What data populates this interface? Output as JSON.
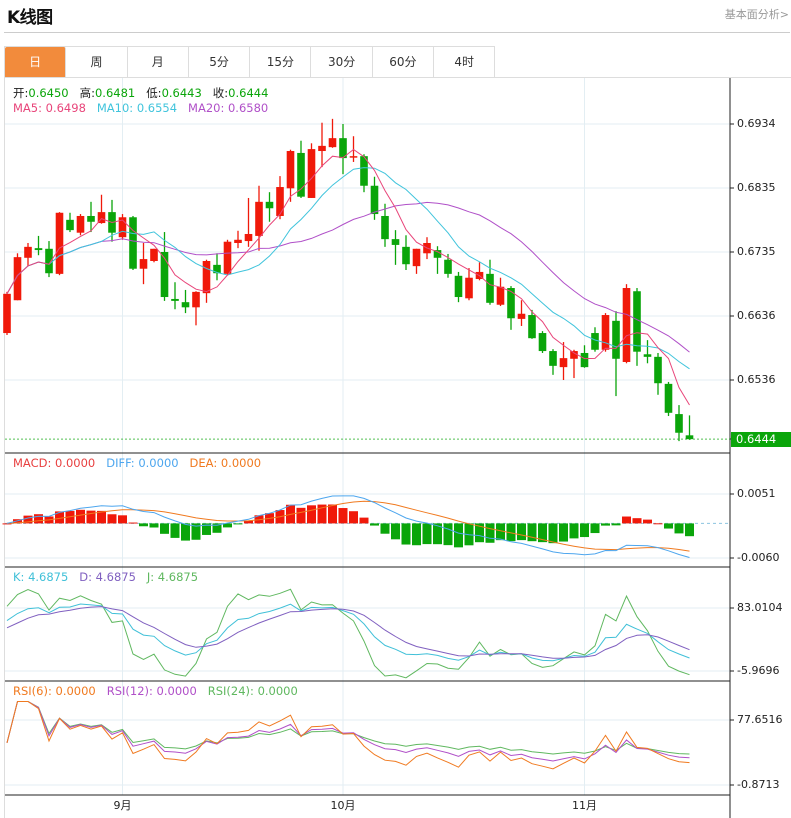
{
  "header": {
    "title": "K线图",
    "fundamental_link": "基本面分析>"
  },
  "tabs": [
    {
      "label": "日",
      "active": true
    },
    {
      "label": "周"
    },
    {
      "label": "月"
    },
    {
      "label": "5分"
    },
    {
      "label": "15分"
    },
    {
      "label": "30分"
    },
    {
      "label": "60分"
    },
    {
      "label": "4时"
    }
  ],
  "ohlc_legend": {
    "open_label": "开:",
    "open": "0.6450",
    "high_label": "高:",
    "high": "0.6481",
    "low_label": "低:",
    "low": "0.6443",
    "close_label": "收:",
    "close": "0.6444"
  },
  "ma_legend": {
    "ma5_label": "MA5:",
    "ma5": "0.6498",
    "ma10_label": "MA10:",
    "ma10": "0.6554",
    "ma20_label": "MA20:",
    "ma20": "0.6580"
  },
  "macd_legend": {
    "macd": "MACD: 0.0000",
    "diff": "DIFF: 0.0000",
    "dea": "DEA: 0.0000"
  },
  "kdj_legend": {
    "k": "K: 4.6875",
    "d": "D: 4.6875",
    "j": "J: 4.6875"
  },
  "rsi_legend": {
    "rsi6": "RSI(6): 0.0000",
    "rsi12": "RSI(12): 0.0000",
    "rsi24": "RSI(24): 0.0000"
  },
  "last_price": "0.6444",
  "colors": {
    "up": "#f0190a",
    "down": "#0aa50a",
    "ma5": "#e8457a",
    "ma10": "#40c4dc",
    "ma20": "#b050c8",
    "diff": "#4da6ee",
    "dea": "#f07a20",
    "k": "#40c0d8",
    "d": "#8060c0",
    "j": "#60b860",
    "accent": "#f28b3c"
  },
  "chart_data": {
    "type": "candlestick",
    "price_axis": {
      "ticks": [
        "0.6934",
        "0.6835",
        "0.6735",
        "0.6636",
        "0.6536"
      ],
      "range": [
        0.6934,
        0.6536
      ]
    },
    "macd_axis": {
      "ticks": [
        "0.0051",
        "-0.0060"
      ],
      "range": [
        0.0051,
        -0.006
      ]
    },
    "kdj_axis": {
      "ticks": [
        "83.0104",
        "-5.9696"
      ],
      "range": [
        83.0104,
        -5.9696
      ]
    },
    "rsi_axis": {
      "ticks": [
        "77.6516",
        "-0.8713"
      ],
      "range": [
        77.6516,
        -0.8713
      ]
    },
    "x_labels": [
      {
        "label": "9月",
        "index": 11
      },
      {
        "label": "10月",
        "index": 32
      },
      {
        "label": "11月",
        "index": 55
      }
    ],
    "candles_ohlc": [
      [
        0.6609,
        0.6673,
        0.6606,
        0.667
      ],
      [
        0.666,
        0.6733,
        0.666,
        0.6727
      ],
      [
        0.6726,
        0.6749,
        0.6713,
        0.6743
      ],
      [
        0.6741,
        0.676,
        0.673,
        0.6738
      ],
      [
        0.674,
        0.6752,
        0.6696,
        0.6702
      ],
      [
        0.6701,
        0.6797,
        0.6699,
        0.6796
      ],
      [
        0.6785,
        0.6796,
        0.6766,
        0.6769
      ],
      [
        0.6765,
        0.6794,
        0.6761,
        0.6791
      ],
      [
        0.6791,
        0.6813,
        0.6766,
        0.6782
      ],
      [
        0.678,
        0.6824,
        0.6779,
        0.6797
      ],
      [
        0.6797,
        0.6816,
        0.6751,
        0.6765
      ],
      [
        0.6758,
        0.6794,
        0.6754,
        0.6789
      ],
      [
        0.6789,
        0.6791,
        0.6707,
        0.6709
      ],
      [
        0.6709,
        0.6749,
        0.6685,
        0.6724
      ],
      [
        0.6721,
        0.674,
        0.6719,
        0.674
      ],
      [
        0.6735,
        0.6766,
        0.6659,
        0.6665
      ],
      [
        0.6662,
        0.6688,
        0.6646,
        0.6659
      ],
      [
        0.6657,
        0.6676,
        0.664,
        0.6649
      ],
      [
        0.6649,
        0.6674,
        0.6621,
        0.6673
      ],
      [
        0.6671,
        0.6723,
        0.6656,
        0.6721
      ],
      [
        0.6715,
        0.6733,
        0.6691,
        0.6702
      ],
      [
        0.6701,
        0.6754,
        0.6699,
        0.6751
      ],
      [
        0.6749,
        0.6768,
        0.6741,
        0.6754
      ],
      [
        0.6752,
        0.6819,
        0.6743,
        0.6763
      ],
      [
        0.676,
        0.6838,
        0.6737,
        0.6813
      ],
      [
        0.6813,
        0.6828,
        0.6782,
        0.6803
      ],
      [
        0.6791,
        0.6853,
        0.6786,
        0.6836
      ],
      [
        0.6834,
        0.6894,
        0.6813,
        0.6892
      ],
      [
        0.6889,
        0.6908,
        0.6819,
        0.6821
      ],
      [
        0.6819,
        0.6904,
        0.6819,
        0.6895
      ],
      [
        0.6892,
        0.6936,
        0.6867,
        0.69
      ],
      [
        0.6898,
        0.6942,
        0.6897,
        0.6912
      ],
      [
        0.6912,
        0.6934,
        0.6856,
        0.6881
      ],
      [
        0.6883,
        0.6915,
        0.6875,
        0.6884
      ],
      [
        0.6884,
        0.6887,
        0.6828,
        0.6838
      ],
      [
        0.6838,
        0.6852,
        0.6785,
        0.6794
      ],
      [
        0.6791,
        0.681,
        0.6743,
        0.6755
      ],
      [
        0.6755,
        0.6769,
        0.6715,
        0.6746
      ],
      [
        0.6743,
        0.6761,
        0.6707,
        0.6716
      ],
      [
        0.6713,
        0.674,
        0.6701,
        0.674
      ],
      [
        0.6733,
        0.6758,
        0.6724,
        0.6749
      ],
      [
        0.6738,
        0.6744,
        0.6701,
        0.6726
      ],
      [
        0.6723,
        0.6732,
        0.6695,
        0.6701
      ],
      [
        0.6698,
        0.6704,
        0.6657,
        0.6665
      ],
      [
        0.6663,
        0.671,
        0.666,
        0.6695
      ],
      [
        0.6693,
        0.6719,
        0.6691,
        0.6704
      ],
      [
        0.6701,
        0.6723,
        0.6653,
        0.6656
      ],
      [
        0.6653,
        0.6695,
        0.6651,
        0.6681
      ],
      [
        0.6679,
        0.6682,
        0.6614,
        0.6632
      ],
      [
        0.6631,
        0.666,
        0.662,
        0.6639
      ],
      [
        0.6637,
        0.6645,
        0.66,
        0.6601
      ],
      [
        0.6609,
        0.6612,
        0.6578,
        0.6581
      ],
      [
        0.6581,
        0.6584,
        0.6544,
        0.6558
      ],
      [
        0.6556,
        0.6595,
        0.6536,
        0.657
      ],
      [
        0.6569,
        0.6583,
        0.6539,
        0.6581
      ],
      [
        0.6578,
        0.659,
        0.6555,
        0.6556
      ],
      [
        0.6609,
        0.6618,
        0.658,
        0.6583
      ],
      [
        0.6583,
        0.664,
        0.658,
        0.6637
      ],
      [
        0.6628,
        0.6643,
        0.6511,
        0.6569
      ],
      [
        0.6564,
        0.6685,
        0.6562,
        0.6679
      ],
      [
        0.6674,
        0.6679,
        0.6558,
        0.658
      ],
      [
        0.6576,
        0.6598,
        0.6562,
        0.6572
      ],
      [
        0.6572,
        0.6578,
        0.6513,
        0.6531
      ],
      [
        0.653,
        0.6533,
        0.648,
        0.6485
      ],
      [
        0.6483,
        0.6497,
        0.6441,
        0.6454
      ],
      [
        0.645,
        0.6481,
        0.6443,
        0.6444
      ]
    ]
  }
}
